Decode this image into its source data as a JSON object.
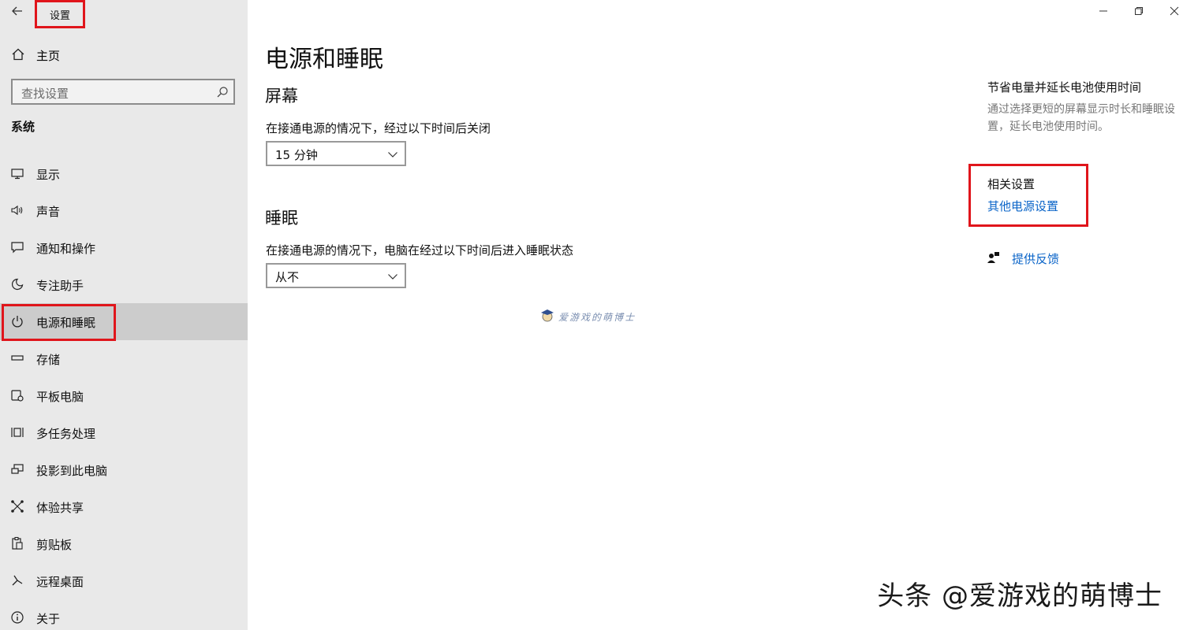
{
  "window": {
    "app_title": "设置",
    "controls": [
      "minimize-icon",
      "restore-icon",
      "close-icon"
    ]
  },
  "sidebar": {
    "home_label": "主页",
    "search_placeholder": "查找设置",
    "section": "系统",
    "items": [
      {
        "label": "显示",
        "icon": "display-icon"
      },
      {
        "label": "声音",
        "icon": "speaker-icon"
      },
      {
        "label": "通知和操作",
        "icon": "notification-icon"
      },
      {
        "label": "专注助手",
        "icon": "moon-icon"
      },
      {
        "label": "电源和睡眠",
        "icon": "power-icon",
        "selected": true
      },
      {
        "label": "存储",
        "icon": "storage-icon"
      },
      {
        "label": "平板电脑",
        "icon": "tablet-icon"
      },
      {
        "label": "多任务处理",
        "icon": "multitask-icon"
      },
      {
        "label": "投影到此电脑",
        "icon": "project-icon"
      },
      {
        "label": "体验共享",
        "icon": "share-icon"
      },
      {
        "label": "剪贴板",
        "icon": "clipboard-icon"
      },
      {
        "label": "远程桌面",
        "icon": "remote-icon"
      },
      {
        "label": "关于",
        "icon": "info-icon"
      }
    ]
  },
  "main": {
    "title": "电源和睡眠",
    "screen": {
      "heading": "屏幕",
      "desc": "在接通电源的情况下，经过以下时间后关闭",
      "value": "15 分钟"
    },
    "sleep": {
      "heading": "睡眠",
      "desc": "在接通电源的情况下，电脑在经过以下时间后进入睡眠状态",
      "value": "从不"
    },
    "watermark": "爱游戏的萌博士"
  },
  "aside": {
    "tip_title": "节省电量并延长电池使用时间",
    "tip_desc": "通过选择更短的屏幕显示时长和睡眠设置，延长电池使用时间。",
    "related_title": "相关设置",
    "related_link": "其他电源设置",
    "feedback": "提供反馈"
  },
  "brand": "头条 @爱游戏的萌博士",
  "colors": {
    "highlight": "#e0151b",
    "link": "#0a64c8",
    "sidebar_bg": "#e9e9e9",
    "selected_bg": "#cccccc"
  }
}
